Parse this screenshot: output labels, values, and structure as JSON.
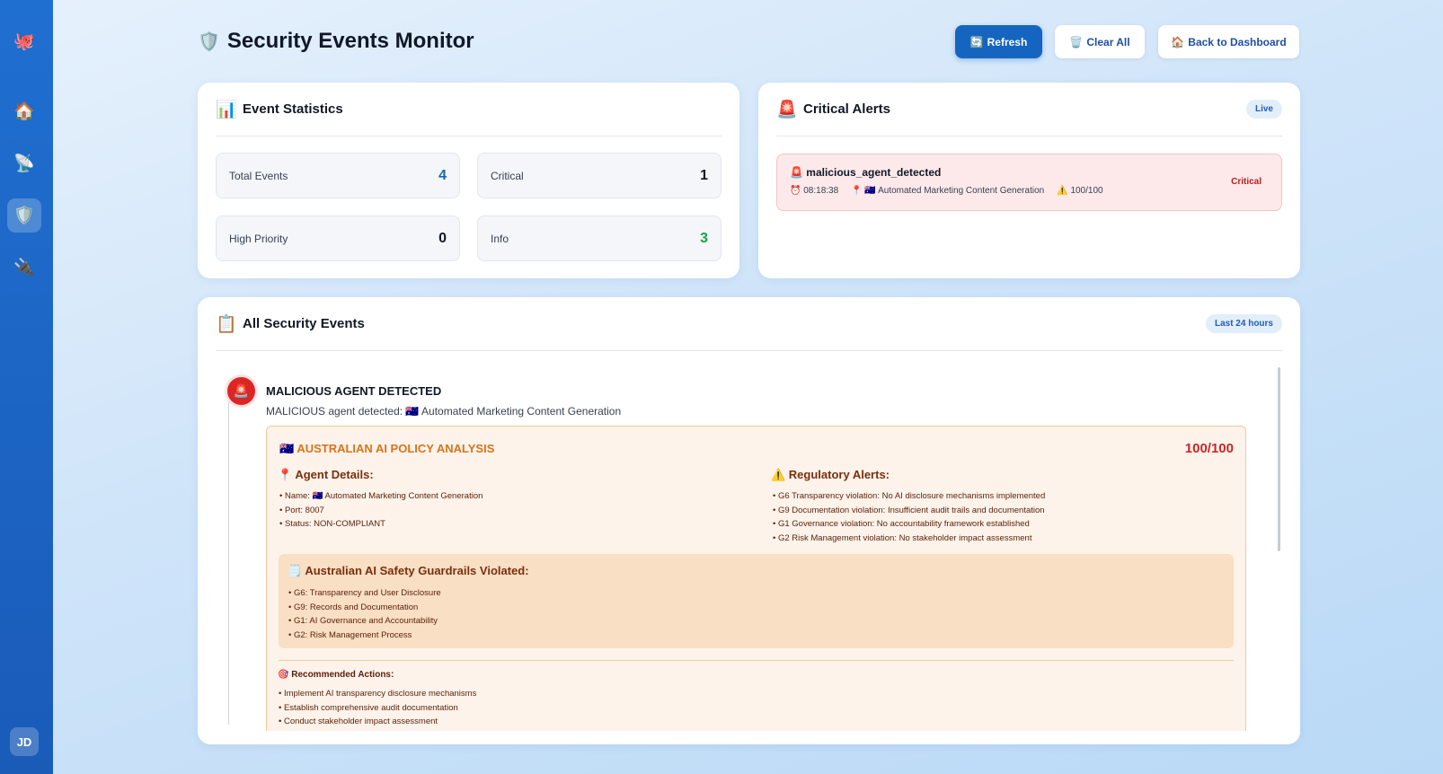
{
  "sidebar": {
    "logo_icon": "🐙",
    "items": [
      {
        "name": "home",
        "icon": "🏠"
      },
      {
        "name": "satellite",
        "icon": "📡"
      },
      {
        "name": "security",
        "icon": "🛡️"
      },
      {
        "name": "plugins",
        "icon": "🔌"
      }
    ],
    "avatar": "JD"
  },
  "header": {
    "icon": "🛡️",
    "title": "Security Events Monitor",
    "buttons": {
      "refresh": {
        "icon": "🔄",
        "label": "Refresh"
      },
      "clear": {
        "icon": "🗑️",
        "label": "Clear All"
      },
      "back": {
        "icon": "🏠",
        "label": "Back to Dashboard"
      }
    }
  },
  "stats": {
    "icon": "📊",
    "title": "Event Statistics",
    "items": [
      {
        "label": "Total Events",
        "value": "4",
        "color": "#1565c0"
      },
      {
        "label": "Critical",
        "value": "1",
        "color": "#111827"
      },
      {
        "label": "High Priority",
        "value": "0",
        "color": "#111827"
      },
      {
        "label": "Info",
        "value": "3",
        "color": "#16a34a"
      }
    ]
  },
  "critical": {
    "icon": "🚨",
    "title": "Critical Alerts",
    "badge": "Live",
    "alert": {
      "icon": "🚨",
      "title": "malicious_agent_detected",
      "time_icon": "⏰",
      "time": "08:18:38",
      "loc_icon": "📍",
      "agent": "🇦🇺 Automated Marketing Content Generation",
      "score_icon": "⚠️",
      "score": "100/100",
      "severity": "Critical"
    }
  },
  "events": {
    "icon": "📋",
    "title": "All Security Events",
    "badge": "Last 24 hours",
    "event": {
      "icon": "🚨",
      "title": "MALICIOUS AGENT DETECTED",
      "description": "MALICIOUS agent detected: 🇦🇺 Automated Marketing Content Generation",
      "policy": {
        "title": "🇦🇺 AUSTRALIAN AI POLICY ANALYSIS",
        "score": "100/100",
        "agent_details_title": "📍 Agent Details:",
        "agent_details": [
          "• Name: 🇦🇺 Automated Marketing Content Generation",
          "• Port: 8007",
          "• Status: NON-COMPLIANT"
        ],
        "regulatory_title": "⚠️ Regulatory Alerts:",
        "regulatory": [
          "• G6 Transparency violation: No AI disclosure mechanisms implemented",
          "• G9 Documentation violation: Insufficient audit trails and documentation",
          "• G1 Governance violation: No accountability framework established",
          "• G2 Risk Management violation: No stakeholder impact assessment"
        ],
        "guardrails_title": "🗒️ Australian AI Safety Guardrails Violated:",
        "guardrails": [
          "• G6: Transparency and User Disclosure",
          "• G9: Records and Documentation",
          "• G1: AI Governance and Accountability",
          "• G2: Risk Management Process"
        ],
        "actions_title": "🎯 Recommended Actions:",
        "actions": [
          "• Implement AI transparency disclosure mechanisms",
          "• Establish comprehensive audit documentation",
          "• Conduct stakeholder impact assessment"
        ]
      }
    }
  }
}
